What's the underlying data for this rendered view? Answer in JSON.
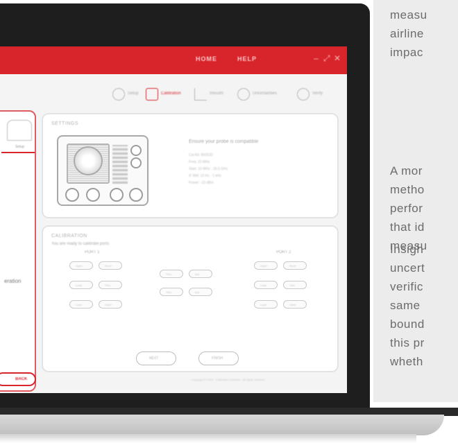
{
  "side_text": {
    "p1": [
      "measu",
      "airline",
      "impac"
    ],
    "p2": [
      "A mor",
      "metho",
      "perfor",
      "that id",
      "measu"
    ],
    "p3": [
      "Insigh",
      "uncert",
      "verific",
      "same",
      "bound",
      "this pr",
      "wheth"
    ]
  },
  "app": {
    "titlebar": {
      "menu": [
        "HOME",
        "HELP"
      ],
      "controls": [
        "–",
        "⤢",
        "✕"
      ]
    },
    "toolbar": {
      "tools": [
        {
          "label": "Setup",
          "icon": "setup-icon",
          "active": false
        },
        {
          "label": "Calibration",
          "icon": "calendar-icon",
          "active": true
        },
        {
          "label": "Results",
          "icon": "chart-icon",
          "active": false
        },
        {
          "label": "Uncertainties",
          "icon": "gear-icon",
          "active": false
        },
        {
          "label": "Verify",
          "icon": "magnifier-icon",
          "active": false
        }
      ]
    },
    "left_card": {
      "caption": "Setup",
      "text": "eration",
      "button_label": "BACK"
    },
    "settings": {
      "title": "SETTINGS",
      "heading": "Ensure your probe is compatible",
      "lines": [
        "Cal Kit: 85052D",
        "Freq: 10 MHz",
        "Start: 10 MHz - 26.5 GHz",
        "IF BW: 10 Hz - 1 kHz",
        "Power: -10 dBm"
      ]
    },
    "calibration": {
      "title": "CALIBRATION",
      "subtitle": "You are ready to calibrate ports",
      "port1": "PORT 1",
      "port2": "PORT 2",
      "port1_buttons": [
        "Open",
        "Short",
        "Load",
        "Thru",
        "Load",
        "Open"
      ],
      "middle_buttons": [
        "Thru",
        "Isol",
        "Thru",
        "Isol"
      ],
      "port2_buttons": [
        "Open",
        "Short",
        "Load",
        "Thru",
        "Load",
        "Open"
      ],
      "actions": [
        "NEXT",
        "FINISH"
      ]
    },
    "footer": "Copyright © 2023 · Calibration software · All rights reserved"
  }
}
